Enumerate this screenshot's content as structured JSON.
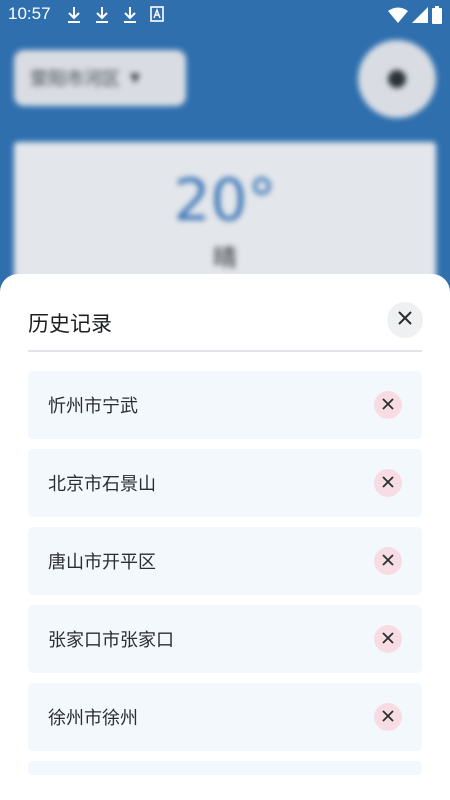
{
  "status_bar": {
    "time": "10:57",
    "notification_icons": [
      "download-icon",
      "download-icon",
      "download-icon",
      "a-icon"
    ],
    "system_icons": [
      "wifi-icon",
      "signal-icon",
      "battery-icon"
    ]
  },
  "background": {
    "location": "荥阳市河区",
    "temperature": "20°",
    "weather": "晴"
  },
  "sheet": {
    "title": "历史记录",
    "close_icon": "close-icon",
    "items": [
      {
        "label": "忻州市宁武"
      },
      {
        "label": "北京市石景山"
      },
      {
        "label": "唐山市开平区"
      },
      {
        "label": "张家口市张家口"
      },
      {
        "label": "徐州市徐州"
      }
    ]
  },
  "colors": {
    "background_blue": "#2f6fae",
    "sheet_background": "#ffffff",
    "item_background": "#f3f8fd",
    "delete_button_background": "#f7dde3"
  }
}
